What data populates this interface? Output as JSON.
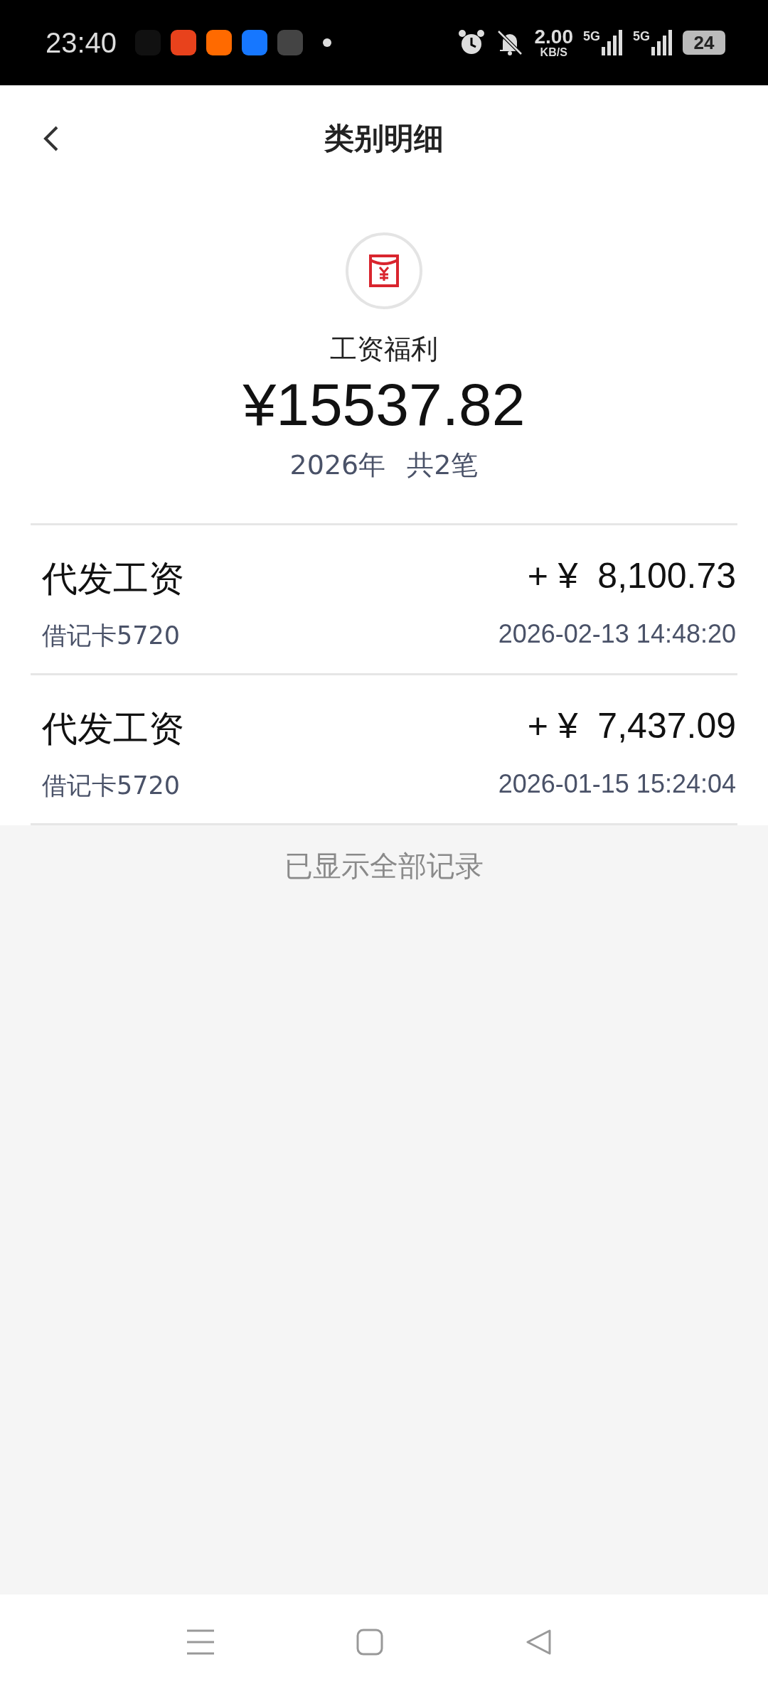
{
  "status_bar": {
    "time": "23:40",
    "speed_value": "2.00",
    "speed_unit": "KB/S",
    "network_1": "5G",
    "network_2": "5G",
    "battery": "24"
  },
  "header": {
    "title": "类别明细"
  },
  "summary": {
    "category": "工资福利",
    "total": "¥15537.82",
    "year": "2026年",
    "count": "共2笔"
  },
  "records": [
    {
      "title": "代发工资",
      "amount": "+ ¥  8,100.73",
      "account": "借记卡5720",
      "time": "2026-02-13 14:48:20"
    },
    {
      "title": "代发工资",
      "amount": "+ ¥  7,437.09",
      "account": "借记卡5720",
      "time": "2026-01-15 15:24:04"
    }
  ],
  "footer_note": "已显示全部记录"
}
